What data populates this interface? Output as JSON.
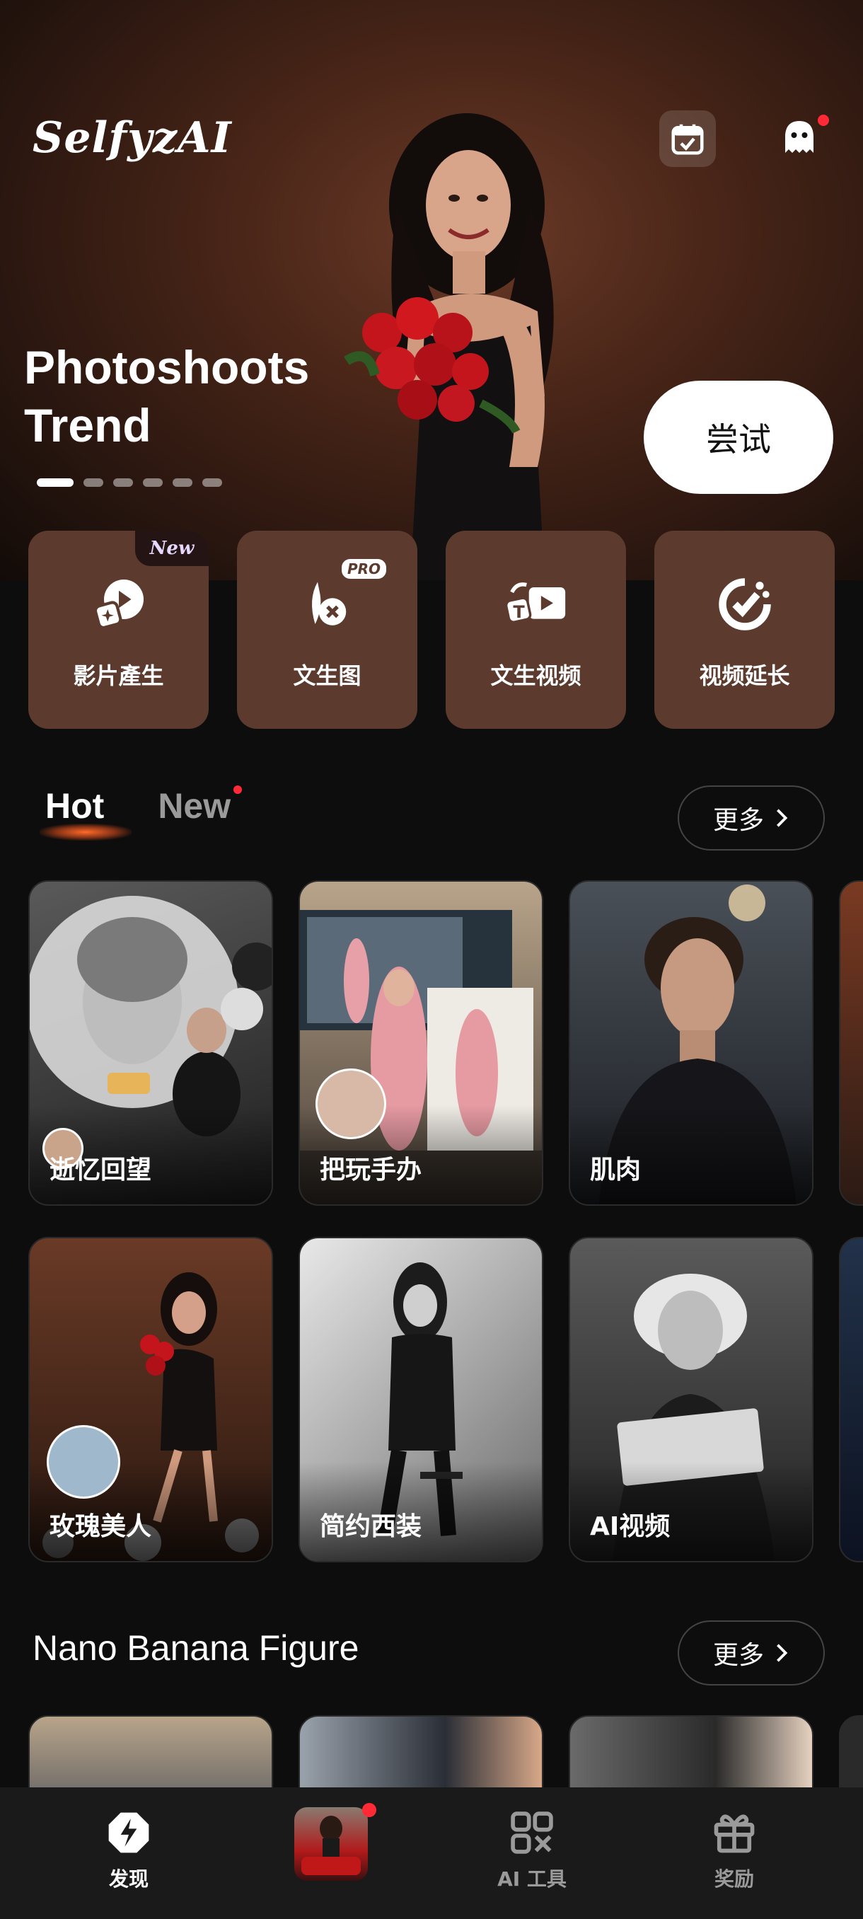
{
  "app": {
    "logo_text": "SelfyzAI"
  },
  "hero": {
    "title": "Photoshoots\nTrend",
    "try_label": "尝试",
    "carousel": {
      "count": 6,
      "active_index": 0
    }
  },
  "header": {
    "calendar_icon": "calendar-check-icon",
    "chat_icon": "ghost-chat-icon",
    "chat_has_notification": true
  },
  "tools": [
    {
      "label": "影片產生",
      "icon": "video-spark-icon",
      "badge": "New"
    },
    {
      "label": "文生图",
      "icon": "text-to-image-icon",
      "badge": "PRO"
    },
    {
      "label": "文生视频",
      "icon": "text-to-video-icon",
      "badge": ""
    },
    {
      "label": "视频延长",
      "icon": "video-extend-icon",
      "badge": ""
    }
  ],
  "tabs": {
    "items": [
      {
        "label": "Hot",
        "active": true
      },
      {
        "label": "New",
        "active": false,
        "has_dot": true
      }
    ],
    "more_label": "更多"
  },
  "hot_cards_row1": [
    {
      "caption": "逝忆回望"
    },
    {
      "caption": "把玩手办"
    },
    {
      "caption": "肌肉"
    }
  ],
  "hot_cards_row2": [
    {
      "caption": "玫瑰美人"
    },
    {
      "caption": "简约西装"
    },
    {
      "caption": "AI视频"
    }
  ],
  "section2": {
    "title": "Nano Banana Figure",
    "more_label": "更多"
  },
  "bottom_nav": [
    {
      "label": "发现",
      "icon": "discover-icon",
      "active": true
    },
    {
      "label": "",
      "icon": "profile-thumbnail",
      "active": false
    },
    {
      "label": "AI 工具",
      "icon": "ai-tools-icon",
      "active": false
    },
    {
      "label": "奖励",
      "icon": "gift-icon",
      "active": false
    }
  ],
  "colors": {
    "accent": "#ff2a36",
    "card_brown": "#5c3a2e",
    "background": "#0d0d0d"
  }
}
